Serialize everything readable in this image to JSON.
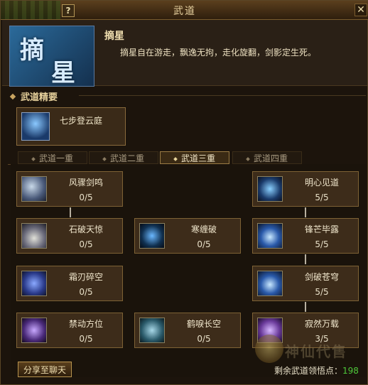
{
  "window": {
    "title": "武道",
    "help_label": "?",
    "close_label": "✕"
  },
  "header": {
    "emblem_chars": [
      "摘",
      "星"
    ],
    "style_name": "摘星",
    "style_desc": "摘星自在游走，飘逸无拘，走化旋翻，剑影定生死。"
  },
  "section": {
    "label": "武道精要"
  },
  "essence": {
    "label": "七步登云庭",
    "icon": "lightning-figure-icon"
  },
  "tabs": [
    {
      "label": "武道一重",
      "active": false
    },
    {
      "label": "武道二重",
      "active": false
    },
    {
      "label": "武道三重",
      "active": true
    },
    {
      "label": "武道四重",
      "active": false
    }
  ],
  "nodes": {
    "fengzhou": {
      "name": "风骤剑鸣",
      "progress": "0/5",
      "icon": "wind-sword-icon"
    },
    "shipo": {
      "name": "石破天惊",
      "progress": "0/5",
      "icon": "stone-break-icon"
    },
    "shuangren": {
      "name": "霜刃碎空",
      "progress": "0/5",
      "icon": "frost-blade-icon"
    },
    "jindong": {
      "name": "禁动方位",
      "progress": "0/5",
      "icon": "forbid-move-icon"
    },
    "hanchan": {
      "name": "寒缠破",
      "progress": "0/5",
      "icon": "cold-bind-icon"
    },
    "heti": {
      "name": "鹤唳长空",
      "progress": "0/5",
      "icon": "crane-cry-icon"
    },
    "mingxin": {
      "name": "明心见道",
      "progress": "5/5",
      "icon": "clear-mind-icon"
    },
    "fengmang": {
      "name": "锋芒毕露",
      "progress": "5/5",
      "icon": "sharp-edge-icon"
    },
    "jianpo": {
      "name": "剑破苍穹",
      "progress": "5/5",
      "icon": "sword-sky-icon"
    },
    "jiran": {
      "name": "寂然万载",
      "progress": "3/5",
      "icon": "silent-ages-icon"
    }
  },
  "footer": {
    "share_label": "分享至聊天",
    "remaining_label": "剩余武道领悟点：",
    "remaining_value": "198"
  },
  "watermark": {
    "text": "神仙代售"
  }
}
